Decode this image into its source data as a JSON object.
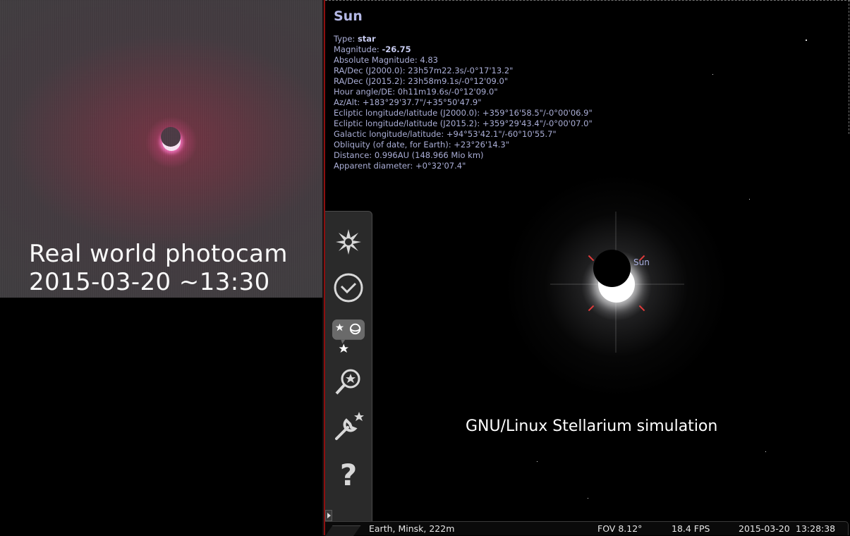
{
  "photo": {
    "caption_line1": "Real world photocam",
    "caption_line2": "2015-03-20 ~13:30"
  },
  "object_info": {
    "title": "Sun",
    "type_label": "Type: ",
    "type_value": "star",
    "magnitude_label": "Magnitude: ",
    "magnitude_value": "-26.75",
    "lines": [
      "Absolute Magnitude: 4.83",
      "RA/Dec (J2000.0): 23h57m22.3s/-0°17'13.2\"",
      "RA/Dec (J2015.2): 23h58m9.1s/-0°12'09.0\"",
      "Hour angle/DE: 0h11m19.6s/-0°12'09.0\"",
      "Az/Alt: +183°29'37.7\"/+35°50'47.9\"",
      "Ecliptic longitude/latitude (J2000.0): +359°16'58.5\"/-0°00'06.9\"",
      "Ecliptic longitude/latitude (J2015.2): +359°29'43.4\"/-0°00'07.0\"",
      "Galactic longitude/latitude: +94°53'42.1\"/-60°10'55.7\"",
      "Obliquity (of date, for Earth): +23°26'14.3\"",
      "Distance: 0.996AU (148.966 Mio km)",
      "Apparent diameter: +0°32'07.4\""
    ]
  },
  "sky": {
    "sun_label": "Sun",
    "caption": "GNU/Linux Stellarium simulation"
  },
  "toolbar": {
    "buttons": [
      "sky-display-icon",
      "clock-icon",
      "deep-sky-icon",
      "search-icon",
      "settings-icon",
      "help-icon"
    ],
    "help_glyph": "?"
  },
  "status_bar": {
    "location": "Earth, Minsk, 222m",
    "fov": "FOV 8.12°",
    "fps": "18.4 FPS",
    "date": "2015-03-20",
    "time": "13:28:38"
  },
  "colors": {
    "info_text": "#aaaed6",
    "title": "#b4b8e6",
    "reticle": "#e23b3b",
    "separator": "#8c1010"
  }
}
